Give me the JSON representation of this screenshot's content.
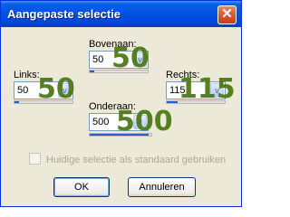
{
  "window": {
    "title": "Aangepaste selectie",
    "close_glyph": "✕"
  },
  "fields": {
    "top": {
      "label": "Bovenaan:",
      "value": "50",
      "overlay": "50",
      "arrow": "v"
    },
    "left": {
      "label": "Links:",
      "value": "50",
      "overlay": "50",
      "arrow": "v"
    },
    "right": {
      "label": "Rechts:",
      "value": "115",
      "overlay": "115",
      "arrow": "v"
    },
    "bottom": {
      "label": "Onderaan:",
      "value": "500",
      "overlay": "500",
      "arrow": "v"
    }
  },
  "checkbox": {
    "label": "Huidige selectie als standaard gebruiken",
    "checked": false,
    "enabled": false
  },
  "buttons": {
    "ok": "OK",
    "cancel": "Annuleren"
  },
  "colors": {
    "titlebar": "#0054e3",
    "overlay_green": "#4f7a17",
    "slider_fill": "#2d5bd6"
  }
}
